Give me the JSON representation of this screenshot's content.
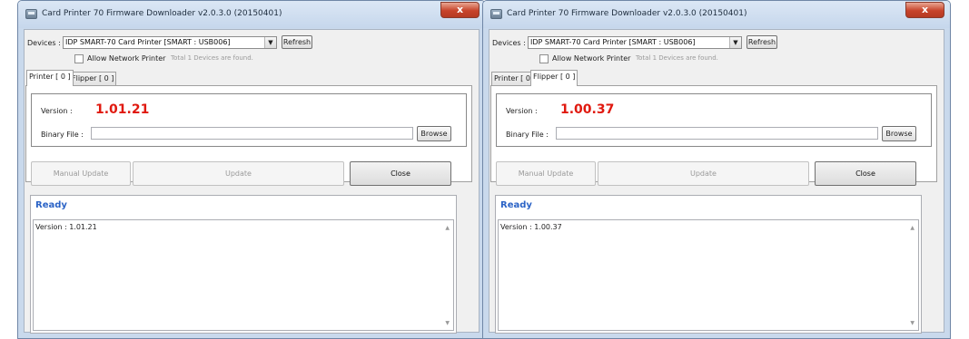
{
  "windows": [
    {
      "title": "Card Printer 70 Firmware Downloader v2.0.3.0 (20150401)",
      "close_symbol": "x",
      "devices_label": "Devices :",
      "device_selected": "IDP SMART-70 Card Printer [SMART : USB006]",
      "refresh_label": "Refresh",
      "allow_network_label": "Allow Network Printer",
      "total_text": "Total   1   Devices are found.",
      "tabs": [
        {
          "label": "Printer [ 0 ]",
          "active": true
        },
        {
          "label": "Flipper [ 0 ]",
          "active": false
        }
      ],
      "version_label": "Version :",
      "version_value": "1.01.21",
      "binary_label": "Binary File :",
      "binary_value": "",
      "browse_label": "Browse",
      "manual_update_label": "Manual Update",
      "update_label": "Update",
      "close_label": "Close",
      "status": "Ready",
      "log_text": "Version : 1.01.21"
    },
    {
      "title": "Card Printer 70 Firmware Downloader v2.0.3.0 (20150401)",
      "close_symbol": "x",
      "devices_label": "Devices :",
      "device_selected": "IDP SMART-70 Card Printer [SMART : USB006]",
      "refresh_label": "Refresh",
      "allow_network_label": "Allow Network Printer",
      "total_text": "Total   1   Devices are found.",
      "tabs": [
        {
          "label": "Printer [ 0 ]",
          "active": false
        },
        {
          "label": "Flipper [ 0 ]",
          "active": true
        }
      ],
      "version_label": "Version :",
      "version_value": "1.00.37",
      "binary_label": "Binary File :",
      "binary_value": "",
      "browse_label": "Browse",
      "manual_update_label": "Manual Update",
      "update_label": "Update",
      "close_label": "Close",
      "status": "Ready",
      "log_text": "Version : 1.00.37"
    }
  ],
  "colors": {
    "version_value": "#e0190f",
    "status_text": "#2b63c6",
    "title_close_button": "#c7432a"
  },
  "icons": {
    "window_icon": "printer-app-icon",
    "dropdown": "chevron-down-icon",
    "scroll_up": "scroll-up-arrow-icon",
    "scroll_down": "scroll-down-arrow-icon"
  }
}
